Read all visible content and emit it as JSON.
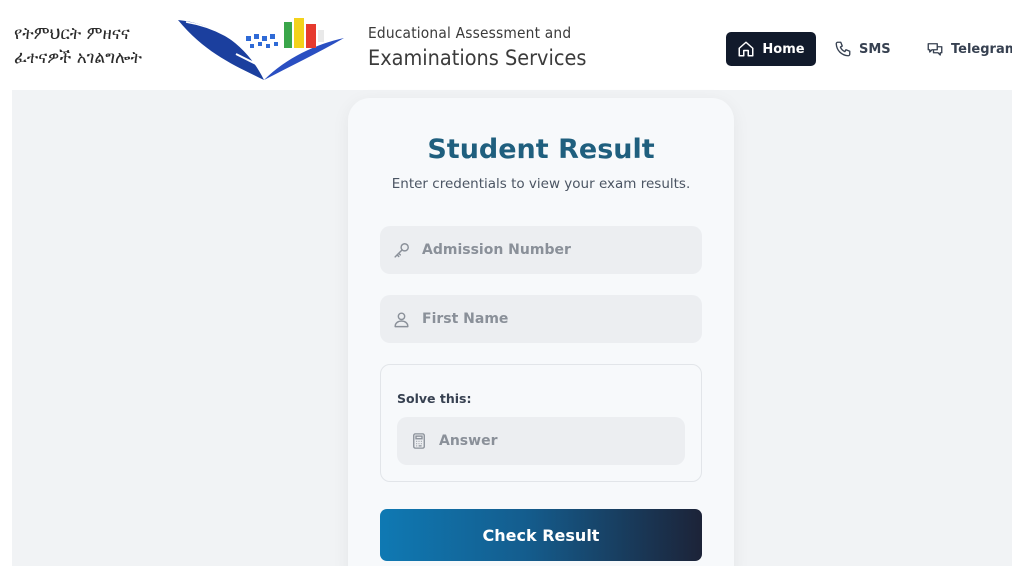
{
  "header": {
    "amharic_line1": "የትምህርት ምዘናና",
    "amharic_line2": "ፈተናዎች አገልግሎት",
    "agency_line1": "Educational Assessment and",
    "agency_line2": "Examinations Services"
  },
  "nav": {
    "home_label": "Home",
    "sms_label": "SMS",
    "telegram_label": "Telegram"
  },
  "card": {
    "title": "Student Result",
    "subtitle": "Enter credentials to view your exam results.",
    "admission_placeholder": "Admission Number",
    "admission_value": "",
    "first_name_placeholder": "First Name",
    "first_name_value": "",
    "captcha_label": "Solve this:",
    "answer_placeholder": "Answer",
    "answer_value": "",
    "submit_label": "Check Result"
  },
  "icons": {
    "home": "home-icon",
    "sms": "phone-icon",
    "telegram": "chat-bubbles-icon",
    "admission": "key-icon",
    "first_name": "user-icon",
    "answer": "calculator-icon"
  },
  "colors": {
    "title": "#1f5f7e",
    "nav_active_bg": "#111a2b",
    "button_gradient_start": "#0f79b3",
    "button_gradient_end": "#1c2338",
    "page_bg": "#f1f3f5"
  }
}
